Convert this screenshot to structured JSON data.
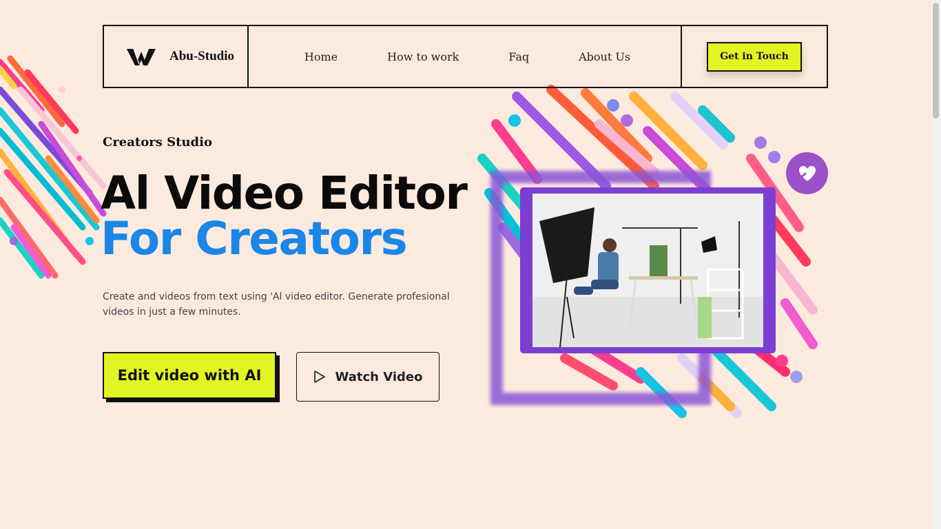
{
  "header": {
    "brand": "Abu-Studio",
    "menu": [
      "Home",
      "How to work",
      "Faq",
      "About Us"
    ],
    "cta": "Get in Touch"
  },
  "hero": {
    "eyebrow": "Creators Studio",
    "title_line1": "Al Video Editor",
    "title_line2": "For Creators",
    "description": "Create and videos from text using 'Al video editor. Generate profesional videos in just a few minutes.",
    "primary_button": "Edit video with AI",
    "secondary_button": "Watch Video"
  },
  "colors": {
    "background": "#fdeade",
    "accent_lime": "#e1f522",
    "accent_blue": "#1a86e8",
    "frame_purple": "#7b3fd3"
  },
  "icons": {
    "logo": "w-logo-icon",
    "play": "play-icon",
    "badge": "heart-hand-icon"
  }
}
